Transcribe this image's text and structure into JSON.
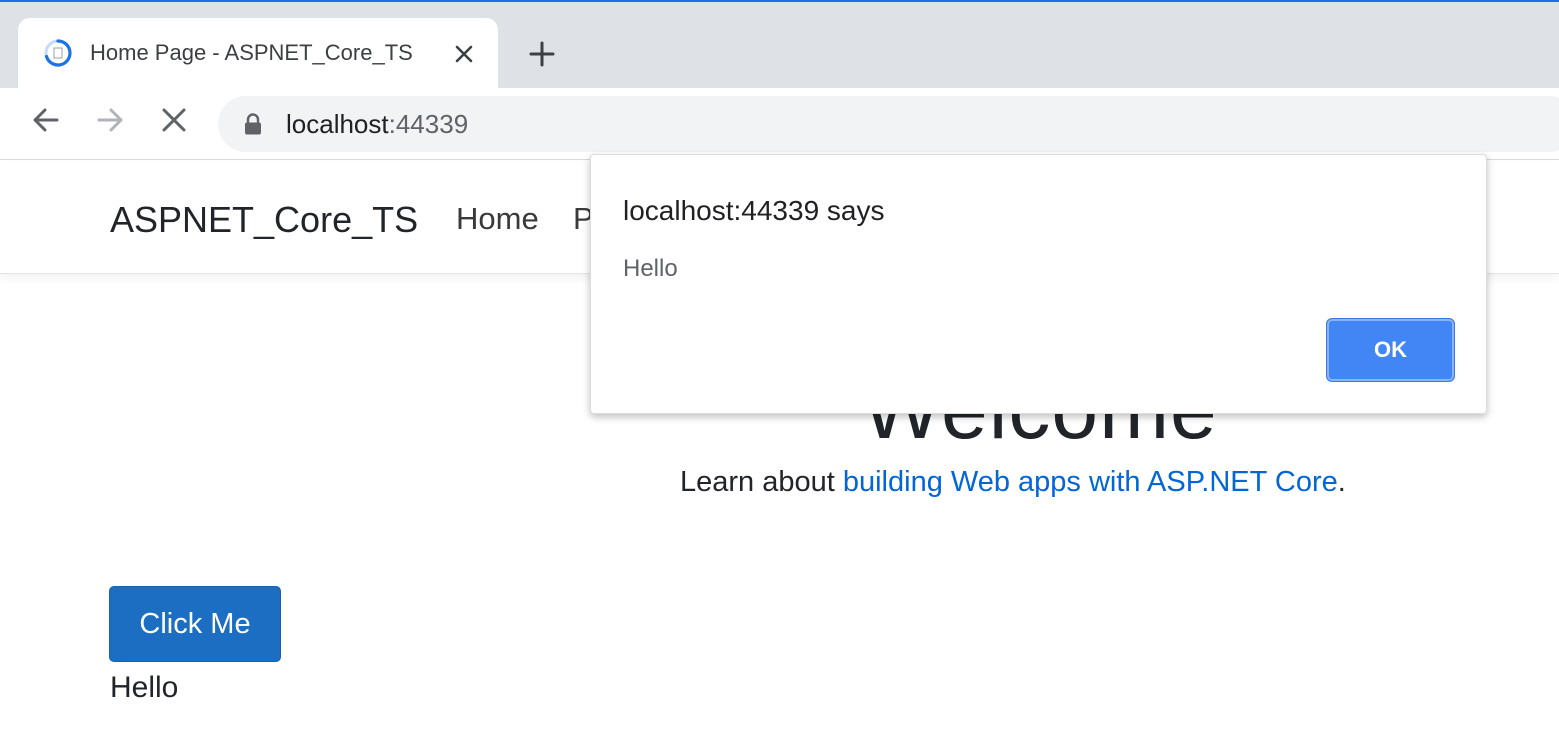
{
  "browser": {
    "tab": {
      "title": "Home Page - ASPNET_Core_TS",
      "favicon": "loading-spinner-icon"
    },
    "toolbar": {
      "back_icon": "back-arrow-icon",
      "forward_icon": "forward-arrow-icon",
      "stop_icon": "stop-loading-icon",
      "url_host": "localhost",
      "url_port": ":44339"
    }
  },
  "site": {
    "brand": "ASPNET_Core_TS",
    "nav": [
      {
        "label": "Home"
      },
      {
        "label": "P"
      }
    ],
    "heading": "Welcome",
    "learn_prefix": "Learn about ",
    "learn_link": "building Web apps with ASP.NET Core",
    "learn_suffix": ".",
    "button_label": "Click Me",
    "output_text": "Hello"
  },
  "dialog": {
    "title": "localhost:44339 says",
    "message": "Hello",
    "ok_label": "OK"
  },
  "colors": {
    "accent": "#1a73e8",
    "primary_button": "#1b6ec2",
    "link": "#0366d6",
    "dialog_ok": "#4285f4"
  }
}
